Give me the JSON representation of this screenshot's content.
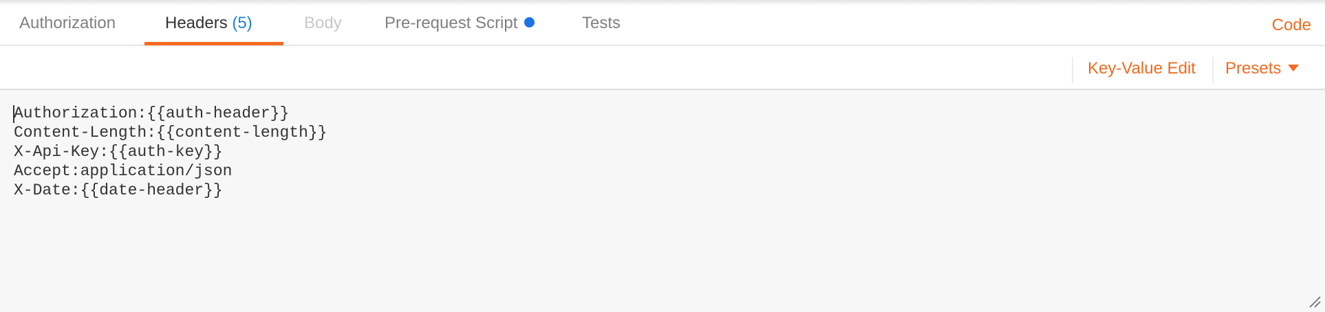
{
  "tabs": [
    {
      "label": "Authorization",
      "state": "normal"
    },
    {
      "label": "Headers",
      "count": "(5)",
      "state": "active"
    },
    {
      "label": "Body",
      "state": "disabled"
    },
    {
      "label": "Pre-request Script",
      "indicator": "blue-dot",
      "state": "normal"
    },
    {
      "label": "Tests",
      "state": "normal"
    }
  ],
  "code_link": "Code",
  "toolbar": {
    "key_value_edit": "Key-Value Edit",
    "presets": "Presets"
  },
  "editor": {
    "lines": [
      "Authorization:{{auth-header}}",
      "Content-Length:{{content-length}}",
      "X-Api-Key:{{auth-key}}",
      "Accept:application/json",
      "X-Date:{{date-header}}"
    ]
  },
  "colors": {
    "accent": "#f26b21",
    "count": "#1f7fd9",
    "dot": "#1a73e8",
    "editor_bg": "#f7f7f7"
  }
}
